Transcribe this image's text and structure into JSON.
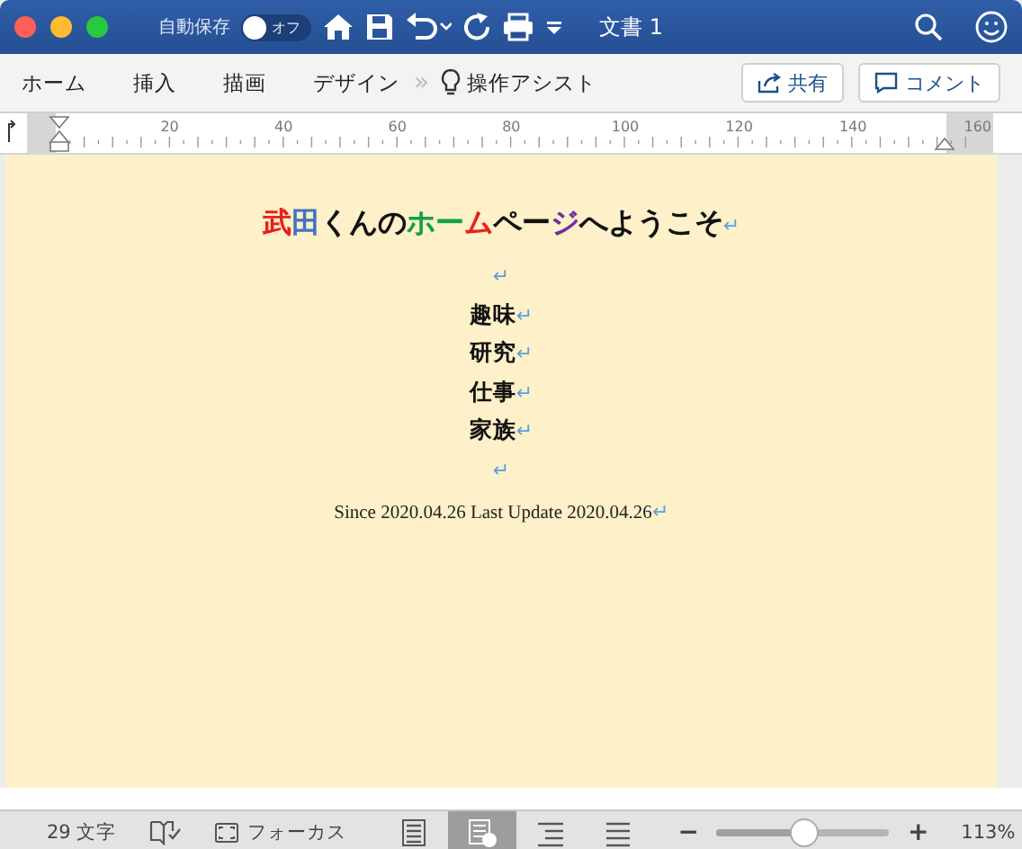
{
  "window": {
    "title": "文書 1",
    "autosave_label": "自動保存",
    "autosave_toggle": {
      "on": false,
      "label": "オフ"
    }
  },
  "ribbon_tabs": [
    {
      "label": "ホーム"
    },
    {
      "label": "挿入"
    },
    {
      "label": "描画"
    },
    {
      "label": "デザイン"
    }
  ],
  "overflow": "»",
  "tell_me": "操作アシスト",
  "share_button": "共有",
  "comment_button": "コメント",
  "ruler": {
    "labels": [
      "20",
      "40",
      "60",
      "80",
      "100",
      "120",
      "140",
      "160"
    ]
  },
  "document": {
    "title_segments": [
      {
        "text": "武",
        "color": "#e8201c"
      },
      {
        "text": "田",
        "color": "#4472c4"
      },
      {
        "text": "くんの",
        "color": "#111111"
      },
      {
        "text": "ホー",
        "color": "#12a14a"
      },
      {
        "text": "ム",
        "color": "#e8201c"
      },
      {
        "text": "ペー",
        "color": "#111111"
      },
      {
        "text": "ジ",
        "color": "#7030a0"
      },
      {
        "text": "へようこそ",
        "color": "#111111"
      }
    ],
    "paragraph_mark": "↵",
    "paragraphs": [
      {
        "kind": "empty"
      },
      {
        "kind": "item",
        "text": "趣味"
      },
      {
        "kind": "item",
        "text": "研究"
      },
      {
        "kind": "item",
        "text": "仕事"
      },
      {
        "kind": "item",
        "text": "家族"
      },
      {
        "kind": "empty"
      },
      {
        "kind": "footer",
        "text": "Since 2020.04.26 Last Update 2020.04.26"
      }
    ]
  },
  "status_bar": {
    "word_count": "29 文字",
    "focus": "フォーカス",
    "views": [
      {
        "kind": "print",
        "selected": false
      },
      {
        "kind": "web",
        "selected": true
      },
      {
        "kind": "outline",
        "selected": false
      },
      {
        "kind": "draft",
        "selected": false
      }
    ],
    "zoom_minus": "−",
    "zoom_plus": "+",
    "zoom_slider": {
      "level": 0.51
    },
    "zoom": "113%"
  }
}
